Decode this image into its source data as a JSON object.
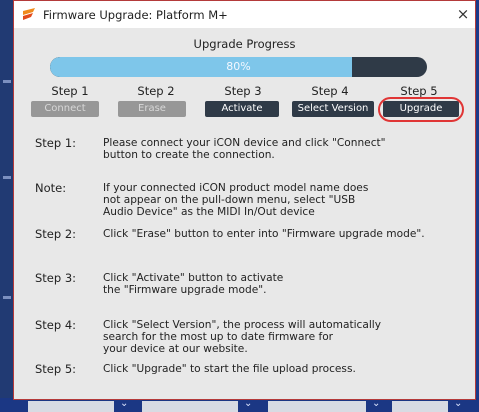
{
  "window": {
    "title": "Firmware Upgrade: Platform M+",
    "close_glyph": "×",
    "icon": "app-icon",
    "close_icon": "close-icon"
  },
  "progress": {
    "title": "Upgrade Progress",
    "percent": 80,
    "label": "80%"
  },
  "steps": [
    {
      "label": "Step 1",
      "button": "Connect",
      "state": "disabled"
    },
    {
      "label": "Step 2",
      "button": "Erase",
      "state": "disabled"
    },
    {
      "label": "Step 3",
      "button": "Activate",
      "state": "active"
    },
    {
      "label": "Step 4",
      "button": "Select Version",
      "state": "active"
    },
    {
      "label": "Step 5",
      "button": "Upgrade",
      "state": "active"
    }
  ],
  "instructions": [
    {
      "label": "Step 1:",
      "text": [
        "Please connect your iCON device and click \"Connect\"",
        "button to create the connection."
      ]
    },
    {
      "label": "Note:",
      "text": [
        "If your connected iCON product model name does",
        "not appear on the pull-down menu, select \"USB",
        "Audio Device\" as the MIDI In/Out device"
      ]
    },
    {
      "label": "Step 2:",
      "text": [
        "Click \"Erase\" button to enter into \"Firmware upgrade mode\"."
      ]
    },
    {
      "label": "Step 3:",
      "text": [
        "Click \"Activate\" button to activate",
        "the \"Firmware upgrade mode\"."
      ]
    },
    {
      "label": "Step 4:",
      "text": [
        "Click \"Select Version\", the process will automatically",
        "search for the most up to date firmware for",
        "your device at our website."
      ]
    },
    {
      "label": "Step 5:",
      "text": [
        "Click \"Upgrade\" to start the file upload process."
      ]
    }
  ],
  "colors": {
    "progress_fill": "#7ec6ea",
    "progress_track": "#2f3a47",
    "button_active": "#2f3a47",
    "button_disabled": "#979797",
    "highlight": "#e03535"
  }
}
